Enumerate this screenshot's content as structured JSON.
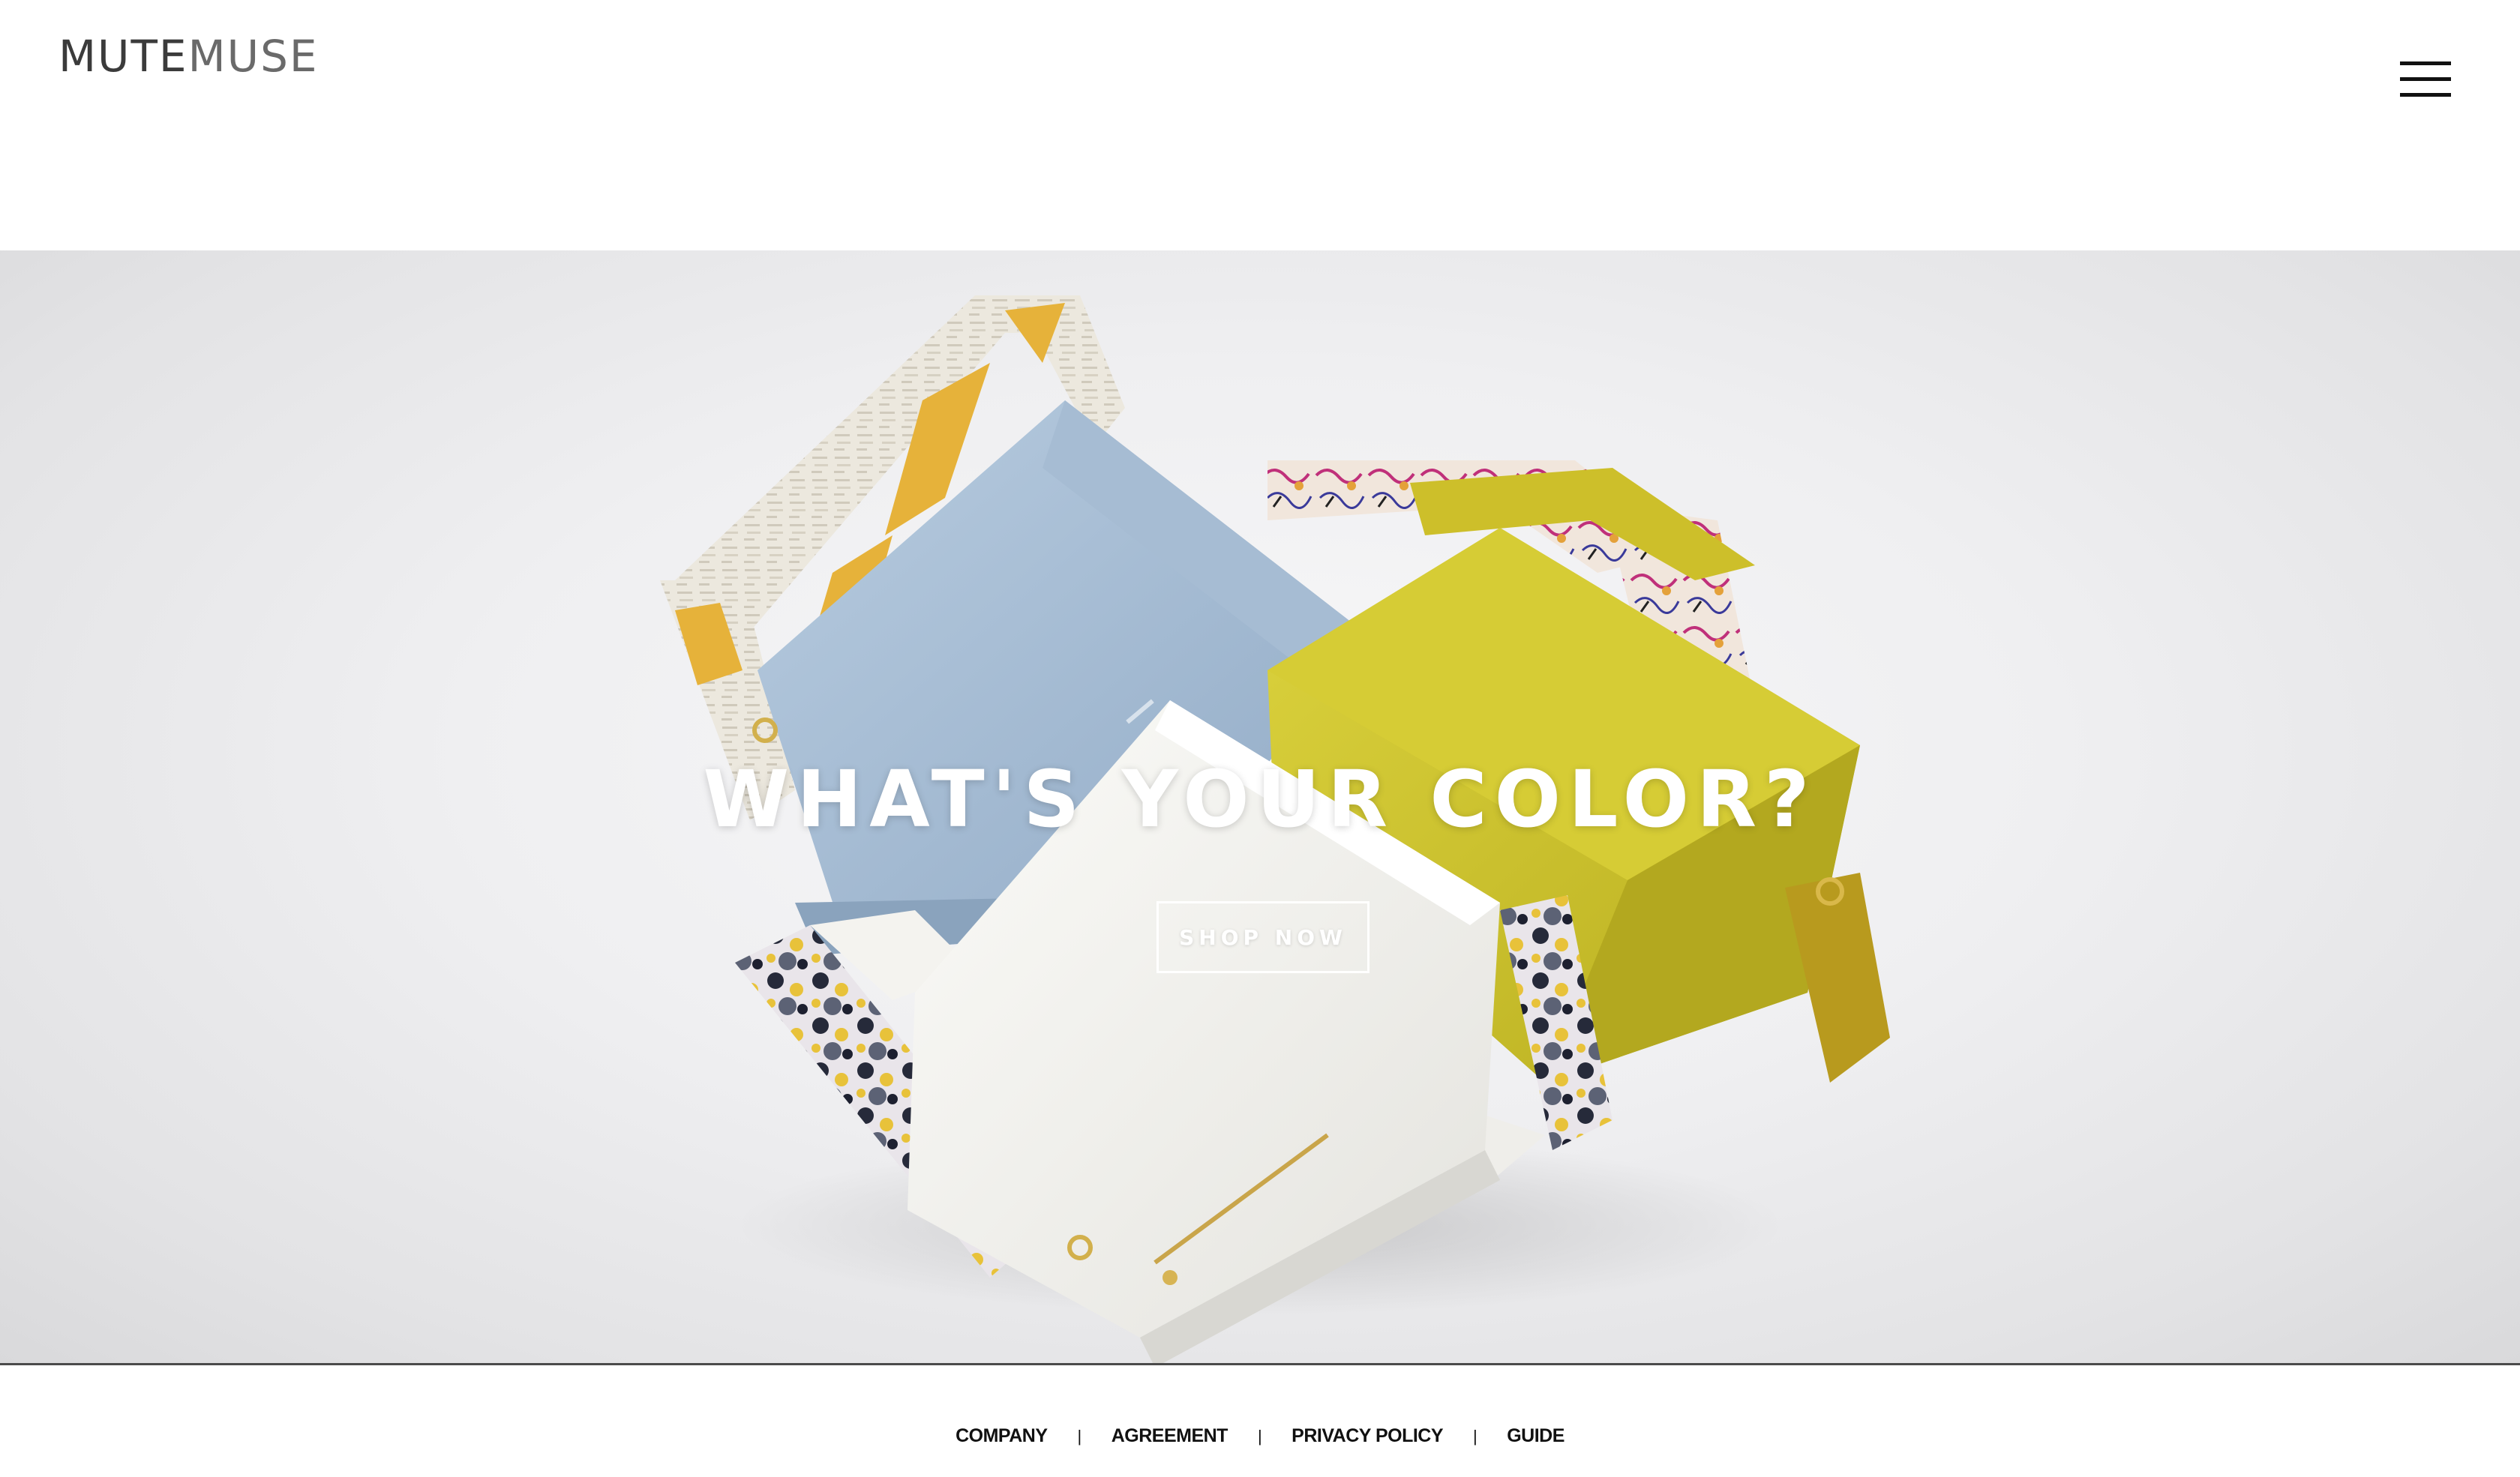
{
  "header": {
    "logo_part1": "MUTE",
    "logo_part2": "MUSE",
    "menu_icon": "hamburger-menu-icon"
  },
  "hero": {
    "title": "WHAT'S YOUR COLOR?",
    "button_label": "SHOP NOW",
    "image_subject": "handbags-photo",
    "colors": {
      "blue_bag": "#a9bfd6",
      "yellow_bag": "#cfc52e",
      "white_bag": "#f3f2ee",
      "strap_accent": "#e8b430"
    }
  },
  "footer": {
    "links": [
      "COMPANY",
      "AGREEMENT",
      "PRIVACY POLICY",
      "GUIDE"
    ],
    "separator": "|"
  }
}
